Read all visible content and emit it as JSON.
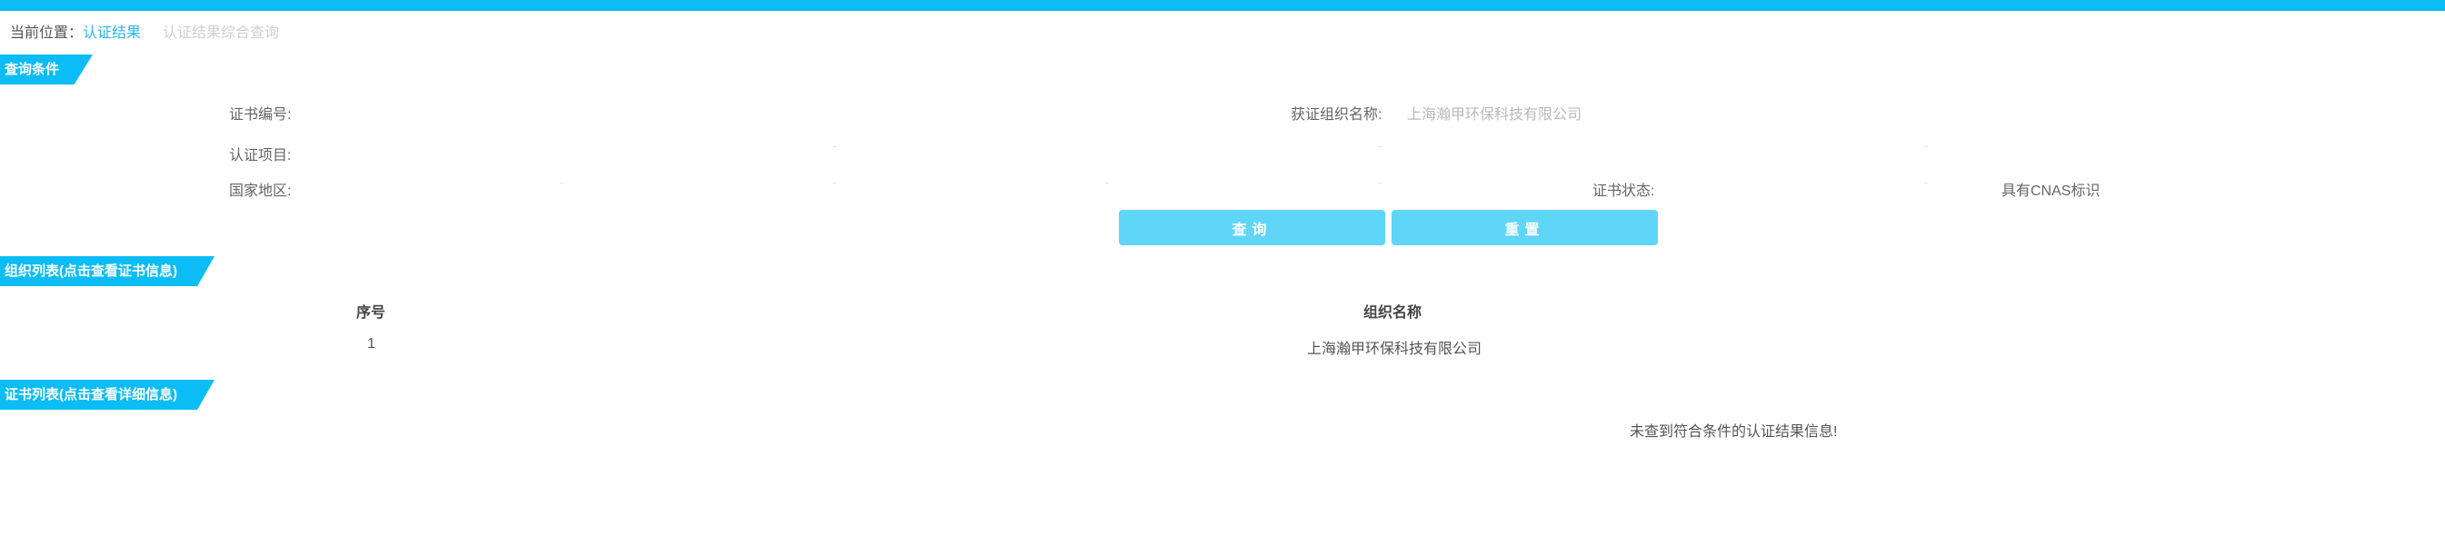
{
  "breadcrumb": {
    "prefix": "当前位置：",
    "current": "认证结果",
    "sub": "认证结果综合查询"
  },
  "sections": {
    "query": "查询条件",
    "org_list": "组织列表(点击查看证书信息)",
    "cert_list": "证书列表(点击查看详细信息)"
  },
  "form": {
    "cert_no_label": "证书编号:",
    "org_name_label": "获证组织名称:",
    "org_name_value": "上海瀚甲环保科技有限公司",
    "project_label": "认证项目:",
    "region_label": "国家地区:",
    "status_label": "证书状态:",
    "cnas_label": "具有CNAS标识"
  },
  "buttons": {
    "query": "查询",
    "reset": "重置"
  },
  "org_table": {
    "columns": [
      "序号",
      "组织名称"
    ],
    "rows": [
      {
        "index": "1",
        "name": "上海瀚甲环保科技有限公司"
      }
    ]
  },
  "cert_table": {
    "empty_message": "未查到符合条件的认证结果信息!"
  },
  "colors": {
    "accent": "#0cbdf5",
    "button": "#5fd5f8"
  }
}
